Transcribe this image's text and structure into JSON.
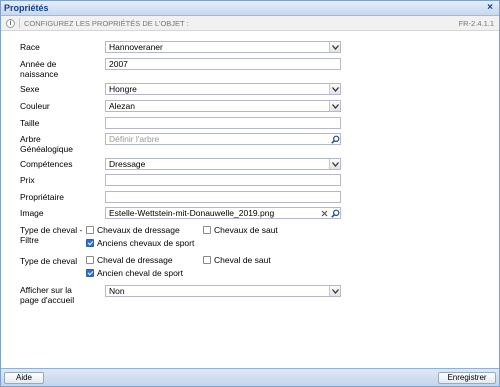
{
  "window": {
    "title": "Propriétés",
    "close_glyph": "×"
  },
  "infobar": {
    "text": "CONFIGUREZ LES PROPRIÉTÉS DE L'OBJET :",
    "version": "FR-2.4.1.1"
  },
  "fields": {
    "race": {
      "label": "Race",
      "value": "Hannoveraner"
    },
    "birth_year": {
      "label": "Année de naissance",
      "value": "2007"
    },
    "sex": {
      "label": "Sexe",
      "value": "Hongre"
    },
    "color": {
      "label": "Couleur",
      "value": "Alezan"
    },
    "size": {
      "label": "Taille",
      "value": ""
    },
    "family_tree": {
      "label": "Arbre Généalogique",
      "placeholder": "Définir l'arbre"
    },
    "skills": {
      "label": "Compétences",
      "value": "Dressage"
    },
    "price": {
      "label": "Prix",
      "value": ""
    },
    "owner": {
      "label": "Propriétaire",
      "value": ""
    },
    "image": {
      "label": "Image",
      "value": "Estelle-Wettstein-mit-Donauwelle_2019.png"
    },
    "filter": {
      "label": "Type de cheval - Filtre",
      "options": [
        {
          "label": "Chevaux de dressage",
          "checked": false
        },
        {
          "label": "Chevaux de saut",
          "checked": false
        },
        {
          "label": "Anciens chevaux de sport",
          "checked": true
        }
      ]
    },
    "horse_type": {
      "label": "Type de cheval",
      "options": [
        {
          "label": "Cheval de dressage",
          "checked": false
        },
        {
          "label": "Cheval de saut",
          "checked": false
        },
        {
          "label": "Ancien cheval de sport",
          "checked": true
        }
      ]
    },
    "homepage": {
      "label": "Afficher sur la page d'accueil",
      "value": "Non"
    }
  },
  "buttons": {
    "help": "Aide",
    "save": "Enregistrer"
  },
  "icons": {
    "info": "info-icon",
    "combo": "chevron-down-icon",
    "search": "search-icon",
    "clear": "clear-icon"
  }
}
